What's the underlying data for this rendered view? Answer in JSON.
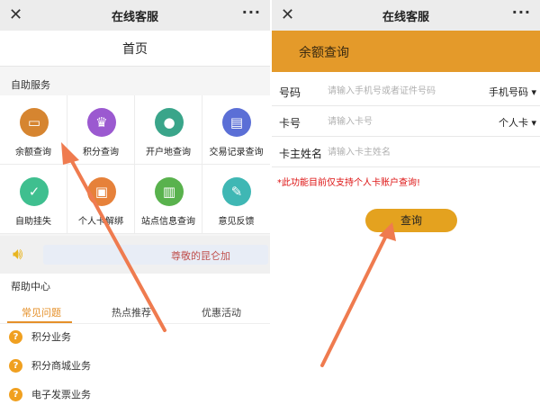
{
  "left": {
    "titlebar": {
      "close": "✕",
      "title": "在线客服",
      "more": "···"
    },
    "header_title": "首页",
    "self_service_label": "自助服务",
    "services": [
      {
        "label": "余额查询",
        "icon": "wallet-icon",
        "glyph": "▭",
        "color": "#d68530"
      },
      {
        "label": "积分查询",
        "icon": "crown-icon",
        "glyph": "♛",
        "color": "#9b59d0"
      },
      {
        "label": "开户地查询",
        "icon": "location-pin-icon",
        "glyph": "●",
        "color": "#3aa58a"
      },
      {
        "label": "交易记录查询",
        "icon": "document-icon",
        "glyph": "▤",
        "color": "#5b6fd6"
      },
      {
        "label": "自助挂失",
        "icon": "shield-check-icon",
        "glyph": "✓",
        "color": "#3fbf8f"
      },
      {
        "label": "个人卡解绑",
        "icon": "id-card-icon",
        "glyph": "▣",
        "color": "#e6813a"
      },
      {
        "label": "站点信息查询",
        "icon": "info-list-icon",
        "glyph": "▥",
        "color": "#59b24d"
      },
      {
        "label": "意见反馈",
        "icon": "edit-icon",
        "glyph": "✎",
        "color": "#3fb7b4"
      }
    ],
    "notice_text": "尊敬的昆仑加",
    "help_center_label": "帮助中心",
    "tabs": [
      "常见问题",
      "热点推荐",
      "优惠活动"
    ],
    "faq": [
      "积分业务",
      "积分商城业务",
      "电子发票业务"
    ]
  },
  "right": {
    "titlebar": {
      "close": "✕",
      "title": "在线客服",
      "more": "···"
    },
    "header_title": "余额查询",
    "fields": [
      {
        "label": "号码",
        "placeholder": "请输入手机号或者证件号码",
        "select": "手机号码 ▾"
      },
      {
        "label": "卡号",
        "placeholder": "请输入卡号",
        "select": "个人卡 ▾"
      },
      {
        "label": "卡主姓名",
        "placeholder": "请输入卡主姓名",
        "select": ""
      }
    ],
    "hint": "*此功能目前仅支持个人卡账户查询!",
    "query_button": "查询"
  },
  "colors": {
    "accent": "#e49a2a",
    "arrow": "#ef7b4f",
    "hint": "#dd1111"
  }
}
